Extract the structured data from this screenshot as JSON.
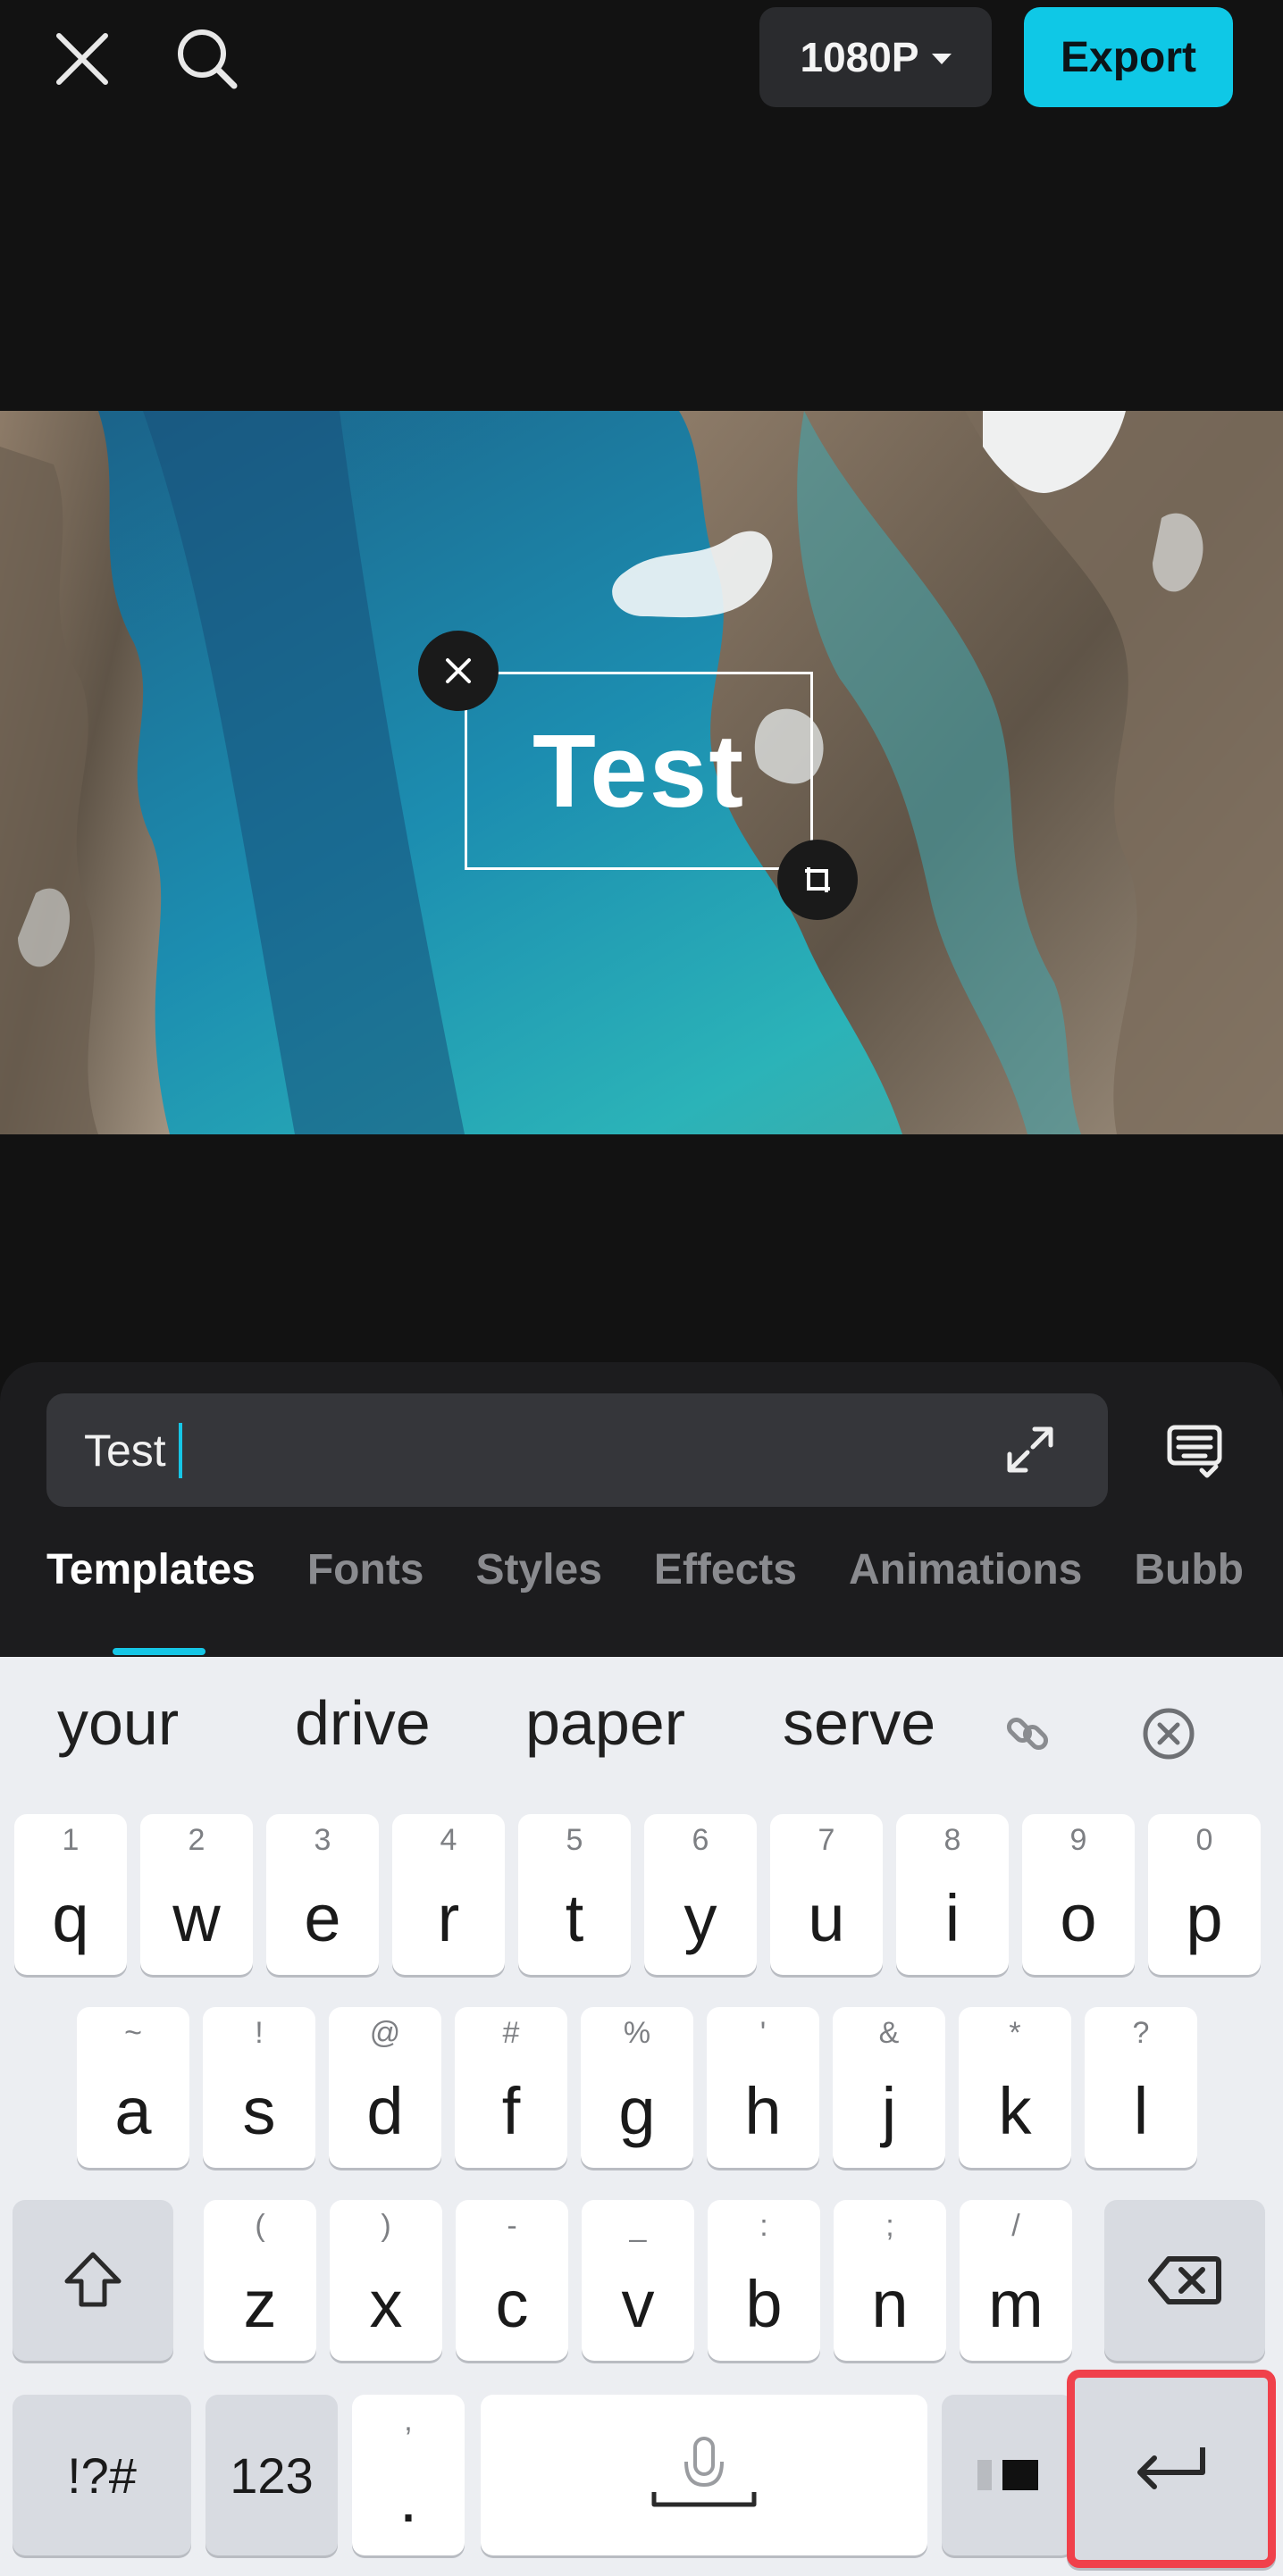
{
  "topbar": {
    "resolution_label": "1080P",
    "export_label": "Export",
    "accent_color": "#0fc8e6"
  },
  "preview": {
    "overlay_text": "Test"
  },
  "editor": {
    "input_value": "Test",
    "tabs": [
      "Templates",
      "Fonts",
      "Styles",
      "Effects",
      "Animations",
      "Bubb"
    ],
    "active_tab": "Templates"
  },
  "keyboard": {
    "suggestions": [
      "your",
      "drive",
      "paper",
      "serve"
    ],
    "row1": [
      {
        "k": "q",
        "s": "1"
      },
      {
        "k": "w",
        "s": "2"
      },
      {
        "k": "e",
        "s": "3"
      },
      {
        "k": "r",
        "s": "4"
      },
      {
        "k": "t",
        "s": "5"
      },
      {
        "k": "y",
        "s": "6"
      },
      {
        "k": "u",
        "s": "7"
      },
      {
        "k": "i",
        "s": "8"
      },
      {
        "k": "o",
        "s": "9"
      },
      {
        "k": "p",
        "s": "0"
      }
    ],
    "row2": [
      {
        "k": "a",
        "s": "~"
      },
      {
        "k": "s",
        "s": "!"
      },
      {
        "k": "d",
        "s": "@"
      },
      {
        "k": "f",
        "s": "#"
      },
      {
        "k": "g",
        "s": "%"
      },
      {
        "k": "h",
        "s": "'"
      },
      {
        "k": "j",
        "s": "&"
      },
      {
        "k": "k",
        "s": "*"
      },
      {
        "k": "l",
        "s": "?"
      }
    ],
    "row3": [
      {
        "k": "z",
        "s": "("
      },
      {
        "k": "x",
        "s": ")"
      },
      {
        "k": "c",
        "s": "-"
      },
      {
        "k": "v",
        "s": "_"
      },
      {
        "k": "b",
        "s": ":"
      },
      {
        "k": "n",
        "s": ";"
      },
      {
        "k": "m",
        "s": "/"
      }
    ],
    "symbols_label": "!?#",
    "numbers_label": "123",
    "punct_main": ".",
    "punct_sub": ","
  }
}
